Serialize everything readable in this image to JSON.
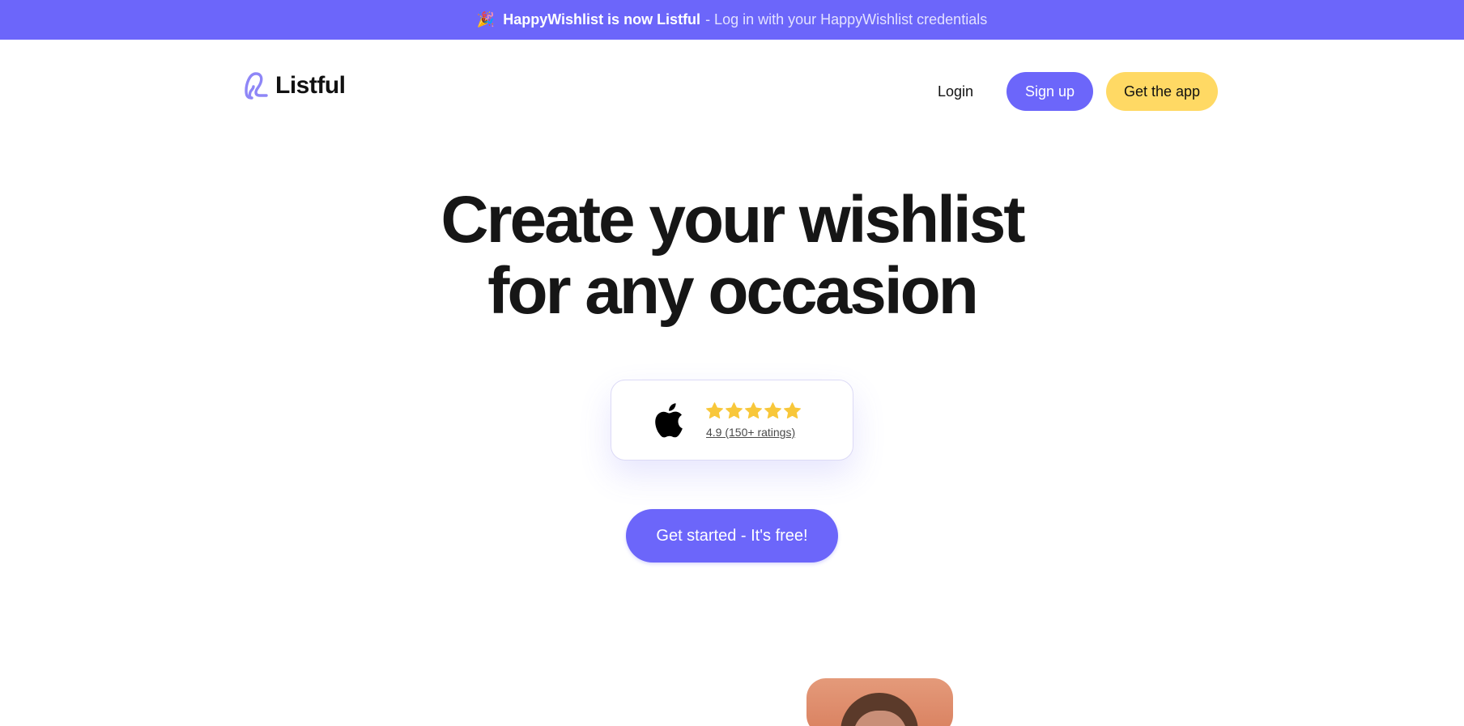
{
  "banner": {
    "emoji": "🎉",
    "highlight": "HappyWishlist is now Listful",
    "rest": "- Log in with your HappyWishlist credentials"
  },
  "header": {
    "logo_text": "Listful",
    "nav": {
      "login": "Login",
      "signup": "Sign up",
      "get_app": "Get the app"
    }
  },
  "hero": {
    "headline_line1": "Create your wishlist",
    "headline_line2": "for any occasion",
    "rating": {
      "store_icon": "apple-icon",
      "stars": 5,
      "text": "4.9 (150+ ratings)"
    },
    "cta": "Get started - It's free!"
  },
  "colors": {
    "brand": "#6c66fa",
    "accent": "#ffd964",
    "star": "#f8c73a"
  }
}
